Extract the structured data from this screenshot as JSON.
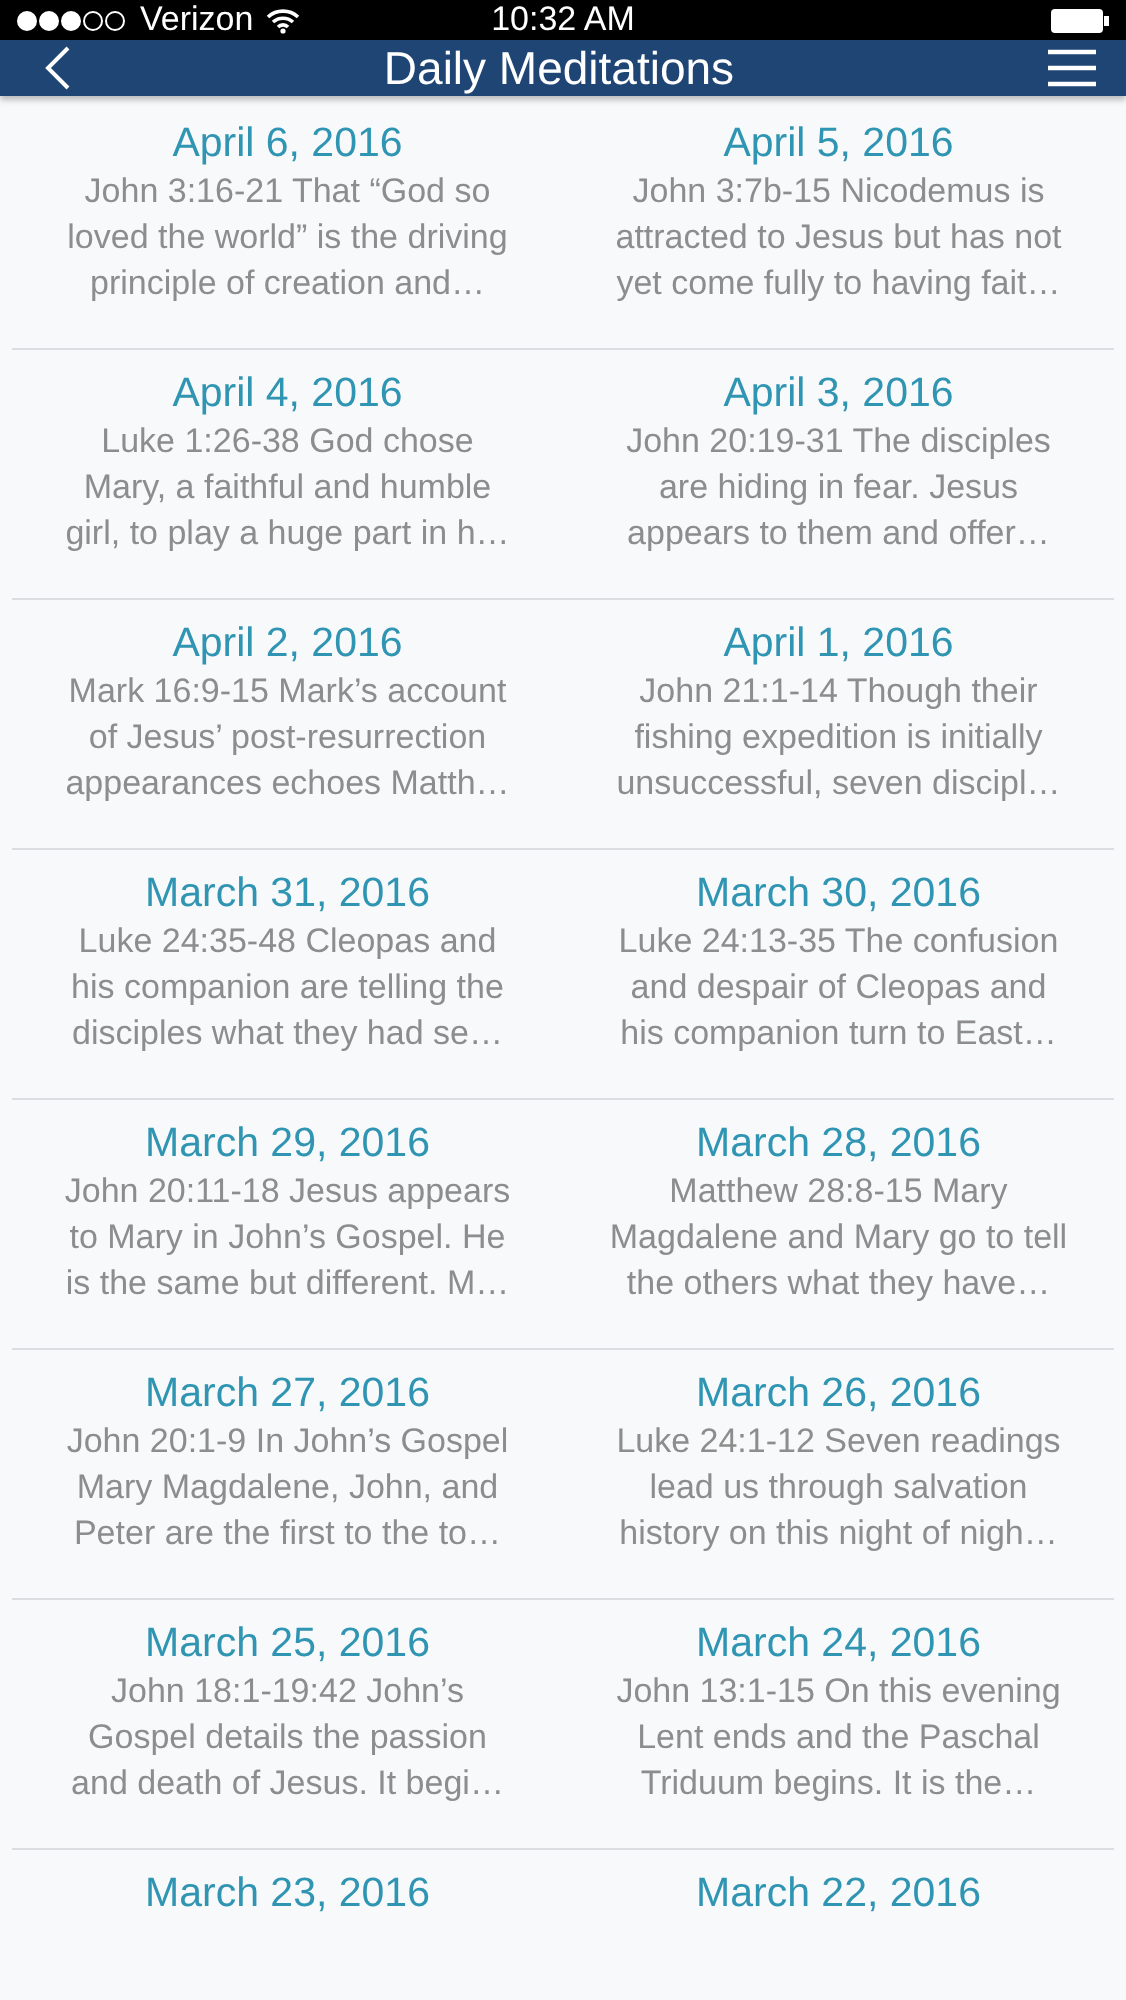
{
  "status_bar": {
    "carrier": "Verizon",
    "time": "10:32 AM"
  },
  "nav_bar": {
    "title": "Daily Meditations"
  },
  "rows": [
    [
      {
        "date": "April 6, 2016",
        "summary": [
          "John 3:16-21 That “God so",
          "loved the world” is the driving",
          "principle of creation and…"
        ]
      },
      {
        "date": "April 5, 2016",
        "summary": [
          "John 3:7b-15 Nicodemus is",
          "attracted to Jesus but has not",
          "yet come fully to having fait…"
        ]
      }
    ],
    [
      {
        "date": "April 4, 2016",
        "summary": [
          "Luke 1:26-38 God chose",
          "Mary, a faithful and humble",
          "girl, to play a huge part in h…"
        ]
      },
      {
        "date": "April 3, 2016",
        "summary": [
          "John 20:19-31 The disciples",
          "are hiding in fear. Jesus",
          "appears to them and offer…"
        ]
      }
    ],
    [
      {
        "date": "April 2, 2016",
        "summary": [
          "Mark 16:9-15 Mark’s account",
          "of Jesus’ post-resurrection",
          "appearances echoes Matth…"
        ]
      },
      {
        "date": "April 1, 2016",
        "summary": [
          "John 21:1-14 Though their",
          "fishing expedition is initially",
          "unsuccessful, seven discipl…"
        ]
      }
    ],
    [
      {
        "date": "March 31, 2016",
        "summary": [
          "Luke 24:35-48 Cleopas and",
          "his companion are telling the",
          "disciples what they had se…"
        ]
      },
      {
        "date": "March 30, 2016",
        "summary": [
          "Luke 24:13-35 The confusion",
          "and despair of Cleopas and",
          "his companion turn to East…"
        ]
      }
    ],
    [
      {
        "date": "March 29, 2016",
        "summary": [
          "John 20:11-18 Jesus appears",
          "to Mary in John’s Gospel. He",
          "is the same but different. M…"
        ]
      },
      {
        "date": "March 28, 2016",
        "summary": [
          "Matthew 28:8-15 Mary",
          "Magdalene and Mary go to tell",
          "the others what they have…"
        ]
      }
    ],
    [
      {
        "date": "March 27, 2016",
        "summary": [
          "John 20:1-9 In John’s Gospel",
          "Mary Magdalene, John, and",
          "Peter are the first to the to…"
        ]
      },
      {
        "date": "March 26, 2016",
        "summary": [
          "Luke 24:1-12 Seven readings",
          "lead us through salvation",
          "history on this night of nigh…"
        ]
      }
    ],
    [
      {
        "date": "March 25, 2016",
        "summary": [
          "John 18:1-19:42 John’s",
          "Gospel details the passion",
          "and death of Jesus.  It begi…"
        ]
      },
      {
        "date": "March 24, 2016",
        "summary": [
          "John 13:1-15 On this evening",
          "Lent ends and the Paschal",
          "Triduum begins. It is the…"
        ]
      }
    ],
    [
      {
        "date": "March 23, 2016"
      },
      {
        "date": "March 22, 2016"
      }
    ]
  ]
}
